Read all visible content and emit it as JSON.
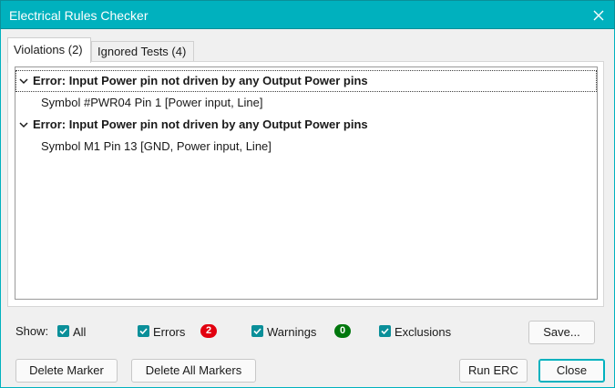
{
  "window": {
    "title": "Electrical Rules Checker",
    "accent_color": "#00b1be"
  },
  "tabs": [
    {
      "label": "Violations (2)",
      "active": true
    },
    {
      "label": "Ignored Tests (4)",
      "active": false
    }
  ],
  "violations": [
    {
      "heading": "Error: Input Power pin not driven by any Output Power pins",
      "item": "Symbol #PWR04 Pin 1 [Power input, Line]"
    },
    {
      "heading": "Error: Input Power pin not driven by any Output Power pins",
      "item": "Symbol M1 Pin 13 [GND, Power input, Line]"
    }
  ],
  "show": {
    "label": "Show:",
    "filters": [
      {
        "label": "All",
        "checked": true
      },
      {
        "label": "Errors",
        "checked": true,
        "badge": "2",
        "badge_color": "#e2000f"
      },
      {
        "label": "Warnings",
        "checked": true,
        "badge": "0",
        "badge_color": "#00770d"
      },
      {
        "label": "Exclusions",
        "checked": true
      }
    ],
    "save_label": "Save..."
  },
  "buttons": {
    "delete_marker": "Delete Marker",
    "delete_all_markers": "Delete All Markers",
    "run_erc": "Run ERC",
    "close": "Close"
  },
  "icons": {
    "close": "close-icon",
    "expand": "chevron-down-icon",
    "checkbox": "checkmark-icon"
  }
}
